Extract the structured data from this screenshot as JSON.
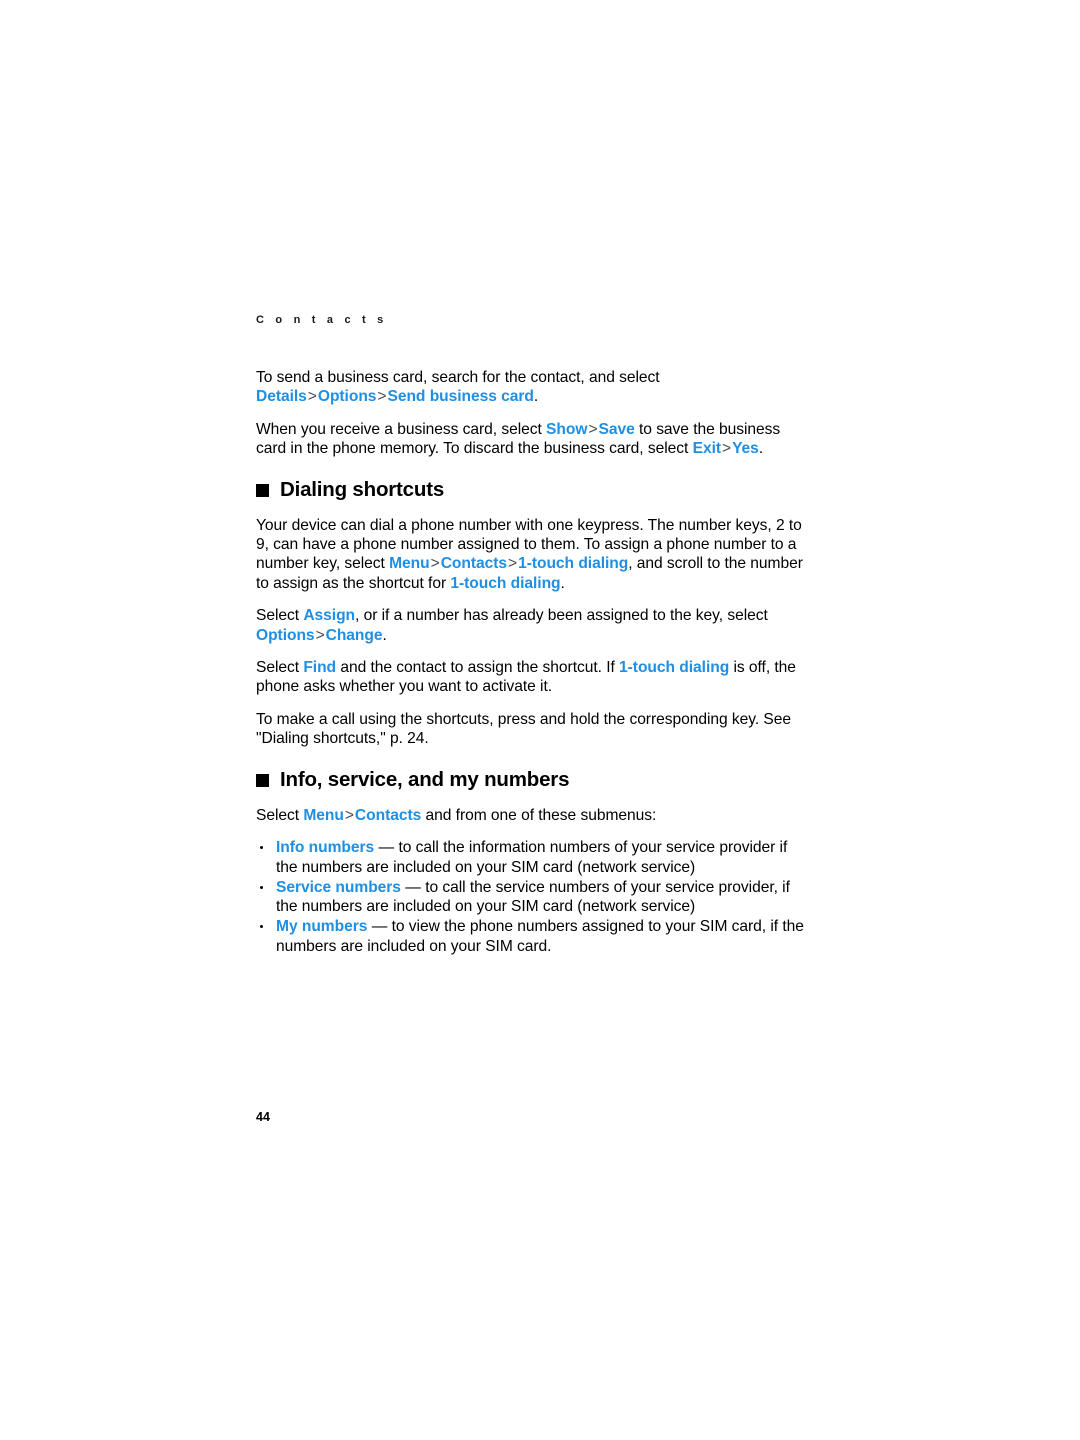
{
  "page": {
    "running_header": "C o n t a c t s",
    "folio": "44",
    "accent_color": "#1e8fe3",
    "separator": ">"
  },
  "intro": {
    "para1": {
      "lead": "To send a business card, search for the contact, and select ",
      "term1": "Details",
      "term2": "Options",
      "term3": "Send business card",
      "tail": "."
    },
    "para2": {
      "lead": "When you receive a business card, select ",
      "term1": "Show",
      "term2": "Save",
      "mid": " to save the business card in the phone memory. To discard the business card, select ",
      "term3": "Exit",
      "term4": "Yes",
      "tail": "."
    }
  },
  "dialing_shortcuts": {
    "heading": "Dialing shortcuts",
    "para1": {
      "lead": "Your device can dial a phone number with one keypress. The number keys, 2 to 9, can have a phone number assigned to them. To assign a phone number to a number key, select ",
      "term1": "Menu",
      "term2": "Contacts",
      "term3": "1-touch dialing",
      "mid": ", and scroll to the number to assign as the shortcut for ",
      "term4": "1-touch dialing",
      "tail": "."
    },
    "para2": {
      "lead": "Select ",
      "term1": "Assign",
      "mid": ", or if a number has already been assigned to the key, select ",
      "term2": "Options",
      "term3": "Change",
      "tail": "."
    },
    "para3": {
      "lead": "Select ",
      "term1": "Find",
      "mid": " and the contact to assign the shortcut. If ",
      "term2": "1-touch dialing",
      "tail": " is off, the phone asks whether you want to activate it."
    },
    "para4": {
      "text": "To make a call using the shortcuts, press and hold the corresponding key. See \"Dialing shortcuts,\" p. 24."
    }
  },
  "info_service_numbers": {
    "heading": "Info, service, and my numbers",
    "intro": {
      "lead": "Select ",
      "term1": "Menu",
      "term2": "Contacts",
      "tail": " and from one of these submenus:"
    },
    "items": [
      {
        "term": "Info numbers",
        "dash": " — ",
        "text": " to call the information numbers of your service provider if the numbers are included on your SIM card (network service)"
      },
      {
        "term": "Service numbers",
        "dash": " — ",
        "text": "to call the service numbers of your service provider, if the numbers are included on your SIM card (network service)"
      },
      {
        "term": "My numbers",
        "dash": " — ",
        "text": " to view the phone numbers assigned to your SIM card, if the numbers are included on your SIM card."
      }
    ]
  }
}
